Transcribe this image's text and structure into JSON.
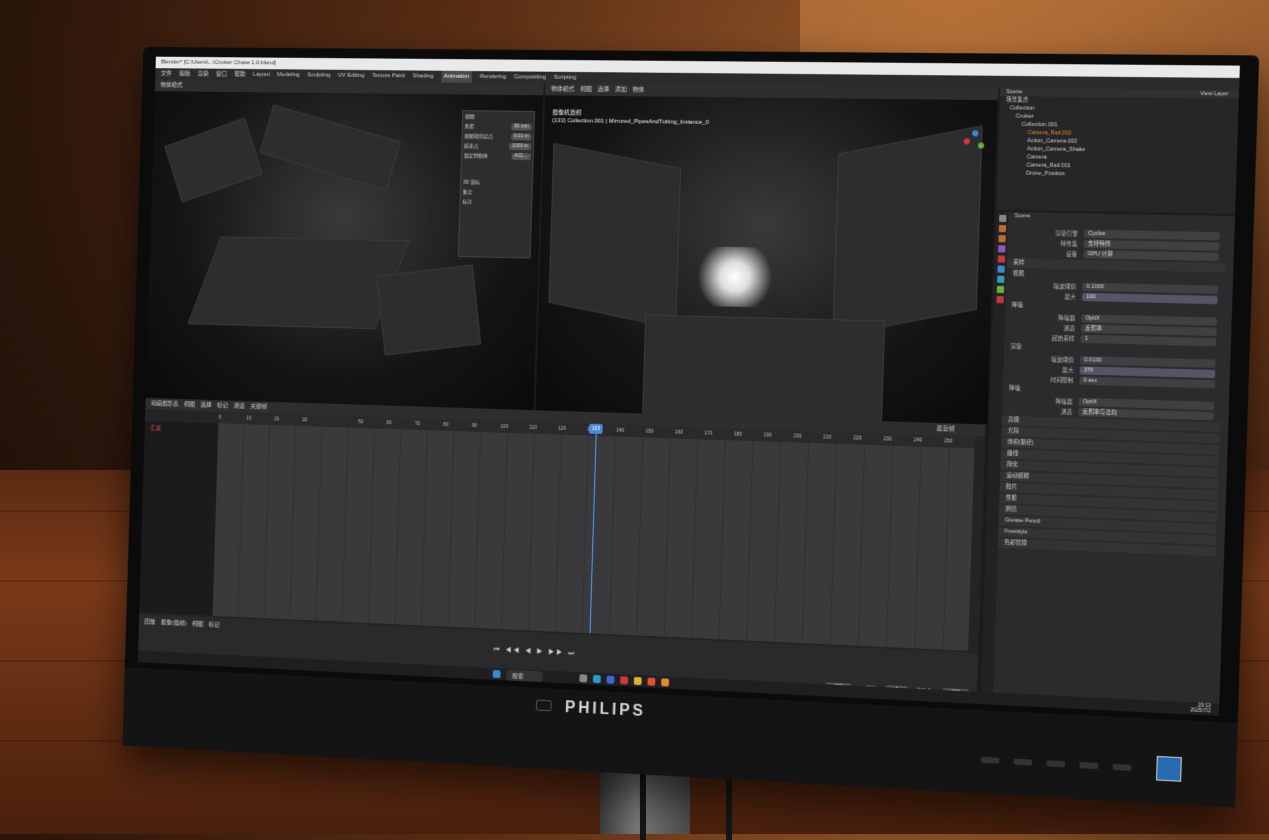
{
  "window": {
    "title": "Blender* [C:\\Users\\...\\Cruiser Chase 1.0.blend]"
  },
  "menu": [
    "文件",
    "编辑",
    "渲染",
    "窗口",
    "帮助"
  ],
  "workspaces": [
    "Layout",
    "Modeling",
    "Sculpting",
    "UV Editing",
    "Texture Paint",
    "Shading",
    "Animation",
    "Rendering",
    "Compositing",
    "Scripting"
  ],
  "active_workspace": "Animation",
  "left_viewport": {
    "mode_label": "物体模式",
    "panel": {
      "title": "视图",
      "rows": [
        {
          "label": "焦距",
          "value": "50 mm"
        },
        {
          "label": "视图裁剪起点",
          "value": "0.01 m"
        },
        {
          "label": "结束点",
          "value": "1000 m"
        }
      ],
      "camera_label": "锁定到物体",
      "camera_value": "ACL...",
      "sections": [
        "3D 游标",
        "集合",
        "标注"
      ]
    }
  },
  "right_viewport": {
    "mode_label": "物体模式",
    "menu": [
      "视图",
      "选择",
      "添加",
      "物体"
    ],
    "info_line1": "摄像机透视",
    "info_line2": "(133) Collection.001 | Mirrored_PipesAndTubing_Instance_0"
  },
  "outliner": {
    "scene_label": "Scene",
    "view_layer": "View Layer",
    "header": "场景集合",
    "items": [
      "Collection",
      "Cruiser",
      "Collection.001",
      "Camera_Rail.002",
      "Action_Camera.002",
      "Action_Camera_Shake",
      "Camera",
      "Camera_Rail.001",
      "Drone_Position"
    ]
  },
  "properties": {
    "scene_name": "Scene",
    "rows": [
      {
        "label": "渲染引擎",
        "value": "Cycles"
      },
      {
        "label": "特性集",
        "value": "支持特性"
      },
      {
        "label": "设备",
        "value": "GPU 计算"
      }
    ],
    "sampling": {
      "title": "采样",
      "viewport_title": "视图",
      "noise_threshold_label": "噪波阈值",
      "noise_threshold": "0.1000",
      "max_samples_label": "最大",
      "max_samples": "100",
      "denoise_label": "降噪",
      "denoiser_label": "降噪器",
      "denoiser": "OptiX",
      "passes_label": "通道",
      "passes": "反照率",
      "start_sample_label": "起始采样",
      "start_sample": "1",
      "render_title": "渲染",
      "render_noise": "0.0100",
      "render_max": "376",
      "time_limit_label": "时间限制",
      "time_limit": "0 sec",
      "render_denoiser": "OptiX",
      "render_passes": "反照率与法向"
    },
    "panels": [
      "高级",
      "光程",
      "体积(路径)",
      "曲线",
      "简化",
      "运动模糊",
      "胶片",
      "性能",
      "烘焙",
      "Grease Pencil",
      "Freestyle",
      "色彩管理"
    ]
  },
  "timeline": {
    "editor_label": "动画摄影表",
    "menu": [
      "视图",
      "选择",
      "标记",
      "通道",
      "关键帧"
    ],
    "summary_label": "汇总",
    "ruler_ticks": [
      "0",
      "10",
      "20",
      "30",
      "50",
      "60",
      "70",
      "80",
      "90",
      "100",
      "110",
      "120",
      "130",
      "140",
      "150",
      "160",
      "170",
      "180",
      "190",
      "200",
      "210",
      "220",
      "230",
      "240",
      "250"
    ],
    "current_frame": "133",
    "playback_menu": [
      "回放",
      "抠像(插帧)",
      "视图",
      "标记"
    ],
    "start_label": "起始",
    "start": "1",
    "end_label": "结束点",
    "end": "900",
    "interp_label": "最近帧"
  },
  "taskbar": {
    "search_placeholder": "搜索",
    "time": "19:13",
    "date": "2025/7/2"
  },
  "monitor": {
    "brand": "PHILIPS"
  },
  "colors": {
    "accent": "#4a8ad8",
    "playhead": "#4aa3ff",
    "orange": "#e08a2a"
  }
}
